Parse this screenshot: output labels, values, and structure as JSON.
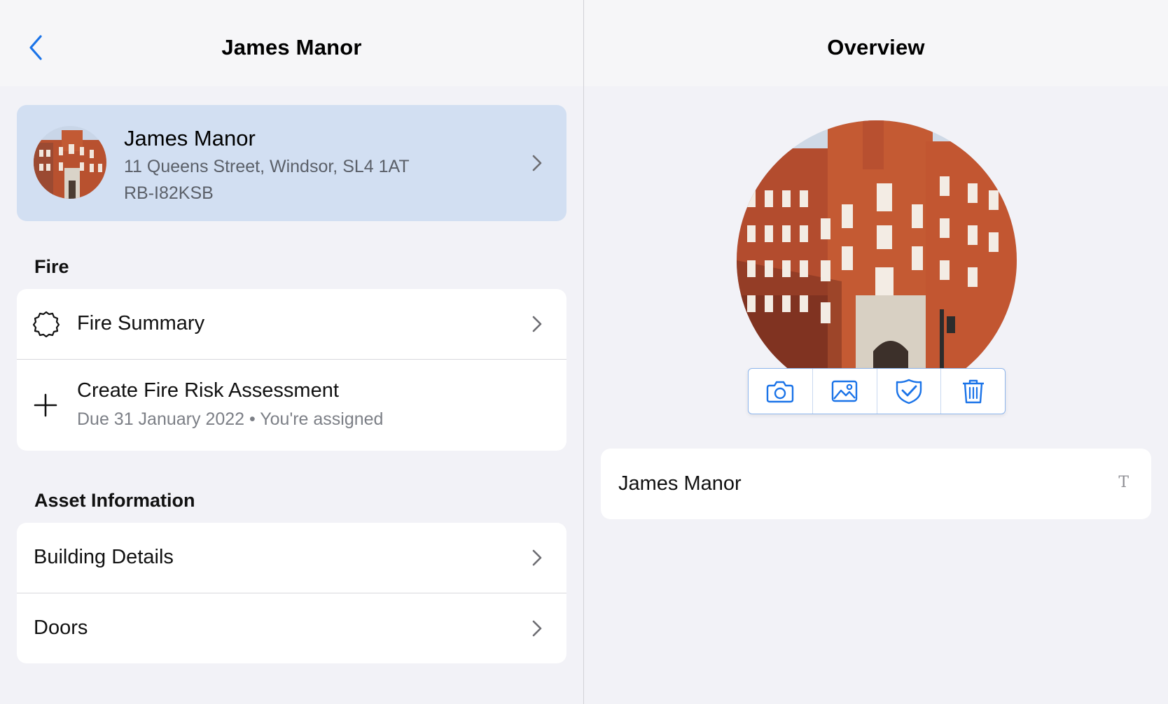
{
  "left": {
    "nav_title": "James Manor",
    "asset": {
      "name": "James Manor",
      "address": "11 Queens Street, Windsor, SL4 1AT",
      "reference": "RB-I82KSB"
    },
    "sections": {
      "fire": {
        "label": "Fire",
        "summary_label": "Fire Summary",
        "create_label": "Create Fire Risk Assessment",
        "due": "Due 31 January 2022 • You're assigned"
      },
      "asset_info": {
        "label": "Asset Information",
        "building_details_label": "Building Details",
        "doors_label": "Doors"
      }
    }
  },
  "right": {
    "nav_title": "Overview",
    "name_field_value": "James Manor",
    "name_field_type_icon": "T",
    "photo_tools": [
      "camera-icon",
      "photo-library-icon",
      "verified-shield-icon",
      "trash-icon"
    ]
  },
  "colors": {
    "accent": "#1a73e8",
    "header_card": "#d2dff2",
    "background": "#f2f2f7"
  }
}
